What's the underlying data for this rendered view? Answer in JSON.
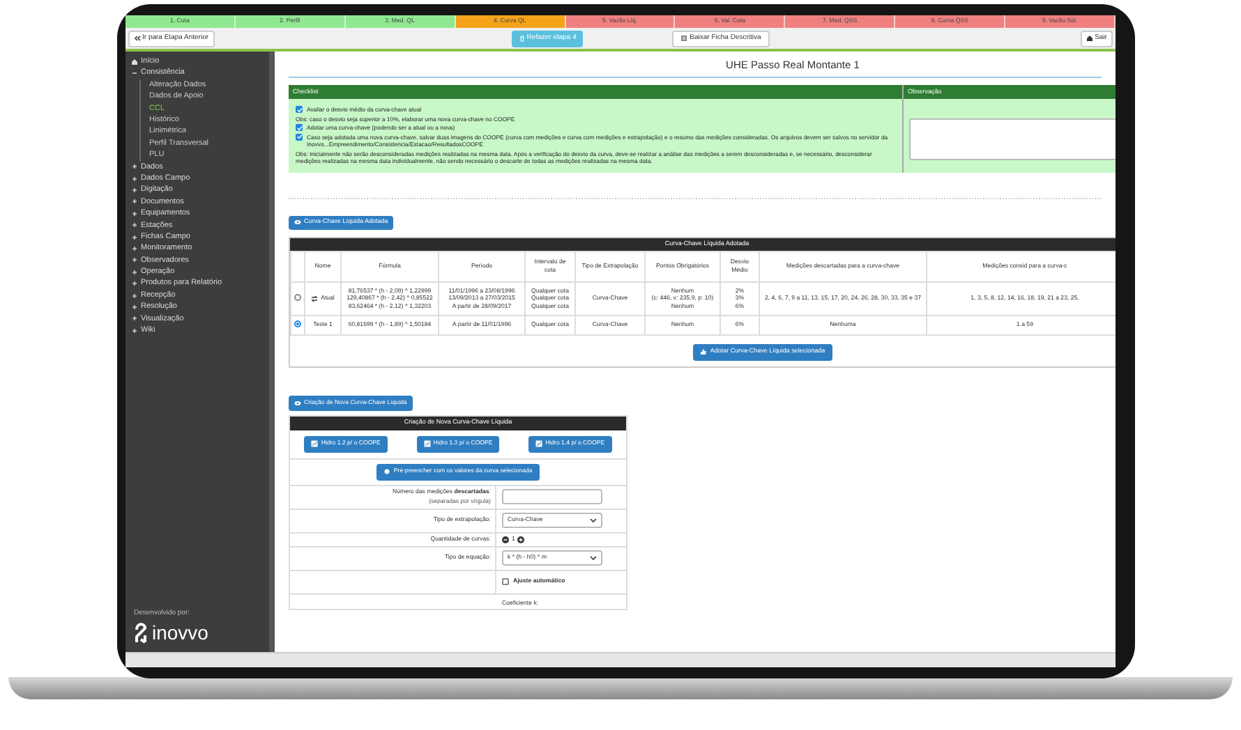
{
  "stages": [
    {
      "label": "1. Cota",
      "color": "#90e890"
    },
    {
      "label": "2. Perfil",
      "color": "#90e890"
    },
    {
      "label": "3. Med. QL",
      "color": "#90e890"
    },
    {
      "label": "4. Curva QL",
      "color": "#f5a31a"
    },
    {
      "label": "5. Vazão Líq.",
      "color": "#f08080"
    },
    {
      "label": "6. Val. Cota",
      "color": "#f08080"
    },
    {
      "label": "7. Med. QSS",
      "color": "#f08080"
    },
    {
      "label": "8. Curva QSS",
      "color": "#f08080"
    },
    {
      "label": "9. Vazão Sól.",
      "color": "#f08080"
    }
  ],
  "toolbar": {
    "back_button": "Ir para Etapa Anterior",
    "redo_button": "Refazer etapa 4",
    "download_button": "Baixar Ficha Descritiva",
    "exit_button": "Sair"
  },
  "sidebar": {
    "items": [
      {
        "label": "Início",
        "kind": "home"
      },
      {
        "label": "Consistência",
        "kind": "group",
        "expanded": true,
        "children": [
          {
            "label": "Alteração Dados",
            "selected": false
          },
          {
            "label": "Dados de Apoio",
            "selected": false
          },
          {
            "label": "CCL",
            "selected": true
          },
          {
            "label": "Histórico",
            "selected": false
          },
          {
            "label": "Linimétrica",
            "selected": false
          },
          {
            "label": "Perfil Transversal",
            "selected": false
          },
          {
            "label": "PLU",
            "selected": false
          }
        ]
      },
      {
        "label": "Dados",
        "kind": "group",
        "expanded": false
      },
      {
        "label": "Dados Campo",
        "kind": "group",
        "expanded": false
      },
      {
        "label": "Digitação",
        "kind": "group",
        "expanded": false
      },
      {
        "label": "Documentos",
        "kind": "group",
        "expanded": false
      },
      {
        "label": "Equipamentos",
        "kind": "group",
        "expanded": false
      },
      {
        "label": "Estações",
        "kind": "group",
        "expanded": false
      },
      {
        "label": "Fichas Campo",
        "kind": "group",
        "expanded": false
      },
      {
        "label": "Monitoramento",
        "kind": "group",
        "expanded": false
      },
      {
        "label": "Observadores",
        "kind": "group",
        "expanded": false
      },
      {
        "label": "Operação",
        "kind": "group",
        "expanded": false
      },
      {
        "label": "Produtos para Relatório",
        "kind": "group",
        "expanded": false
      },
      {
        "label": "Recepção",
        "kind": "group",
        "expanded": false
      },
      {
        "label": "Resolução",
        "kind": "group",
        "expanded": false
      },
      {
        "label": "Visualização",
        "kind": "group",
        "expanded": false
      },
      {
        "label": "Wiki",
        "kind": "group",
        "expanded": false
      }
    ],
    "developed_by": "Desenvolvido por:",
    "logo": "inovvo"
  },
  "title": "UHE Passo Real Montante 1",
  "checklist": {
    "header": "Checklist",
    "observation_header": "Observação",
    "items": [
      {
        "kind": "check",
        "checked": true,
        "text": "Avaliar o desvio médio da curva-chave atual"
      },
      {
        "kind": "note",
        "text": "Obs: caso o desvio seja superior a 10%, elaborar uma nova curva-chave no COOPE"
      },
      {
        "kind": "check",
        "checked": true,
        "text": "Adotar uma curva-chave (podendo ser a atual ou a nova)"
      },
      {
        "kind": "check",
        "checked": true,
        "text": "Caso seja adotada uma nova curva-chave, salvar duas imagens do COOPE (curva com medições e curva com medições e extrapolação) e o resumo das medições consideradas. Os arquivos devem ser salvos no servidor da Inovvo...Empreendimento/Consistencia/Estacao/ResultadosCOOPE"
      },
      {
        "kind": "note",
        "text": "Obs: Inicialmente não serão desconsideradas medições realizadas na mesma data. Após a verificação do desvio da curva, deve-se realizar a análise das medições a serem desconsideradas e, se necessário, desconsiderar medições realizadas na mesma data individualmente, não sendo necessário o descarte de todas as medições realizadas na mesma data."
      }
    ]
  },
  "adopted_button": "Curva-Chave Líquida Adotada",
  "table": {
    "title": "Curva-Chave Líquida Adotada",
    "columns": [
      "Nome",
      "Fórmula",
      "Período",
      "Intervalo de cota",
      "Tipo de Extrapolação",
      "Pontos Obrigatórios",
      "Desvio Médio",
      "Medições descartadas para a curva-chave",
      "Medições consid para a curva-c"
    ],
    "rows": [
      {
        "kind": "current",
        "selected": false,
        "name": "Atual",
        "formula": [
          "81,76537 * (h - 2,09) ^ 1,22999",
          "129,40867 * (h - 2,42) ^ 0,85522",
          "83,62464 * (h - 2,12) ^ 1,32203"
        ],
        "period": [
          "11/01/1996 a 23/08/1996",
          "13/09/2013 a 27/03/2015",
          "A partir de 28/09/2017"
        ],
        "interval": [
          "Qualquer cota",
          "Qualquer cota",
          "Qualquer cota"
        ],
        "extrapolation": "Curva-Chave",
        "points": [
          "Nenhum",
          "(c: 446, v: 235.9, p: 10)",
          "Nenhum"
        ],
        "deviation": [
          "2%",
          "3%",
          "6%"
        ],
        "discarded": "2, 4, 6, 7, 9 a 11, 13, 15, 17, 20, 24, 26, 28, 30, 33, 35 e 37",
        "considered": "1, 3, 5, 8, 12, 14, 16, 18, 19, 21 a 23, 25,"
      },
      {
        "kind": "test",
        "selected": true,
        "name": "Teste 1",
        "formula": [
          "60,81699 * (h - 1,89) ^ 1,50184"
        ],
        "period": [
          "A partir de 11/01/1996"
        ],
        "interval": [
          "Qualquer cota"
        ],
        "extrapolation": "Curva-Chave",
        "points": [
          "Nenhum"
        ],
        "deviation": [
          "6%"
        ],
        "discarded": "Nenhuma",
        "considered": "1 a 59"
      }
    ]
  },
  "adopt_button": "Adotar Curva-Chave Líquida selecionada",
  "create_button": "Criação de Nova Curva-Chave Líquida",
  "create_panel": {
    "title": "Criação de Nova Curva-Chave Líquida",
    "hidro_buttons": [
      "Hidro 1.2 p/ o COOPE",
      "Hidro 1.3 p/ o COOPE",
      "Hidro 1.4 p/ o COOPE"
    ],
    "prefill_button": "Pré-preencher com os valores da curva selecionada",
    "fields": [
      {
        "kind": "text",
        "label": "Número das medições **descartadas**:",
        "hint": "(separadas por vírgula)"
      },
      {
        "kind": "select",
        "label": "Tipo de extrapolação:",
        "value": "Curva-Chave"
      },
      {
        "kind": "stepper",
        "label": "Quantidade de curvas:",
        "value": "1"
      },
      {
        "kind": "select",
        "label": "Tipo de equação:",
        "value": "k * (h - h0) ^ m"
      },
      {
        "kind": "checkbox",
        "label": "Ajuste automático",
        "checked": false
      },
      {
        "kind": "label",
        "label": "Coeficiente k:"
      }
    ]
  }
}
